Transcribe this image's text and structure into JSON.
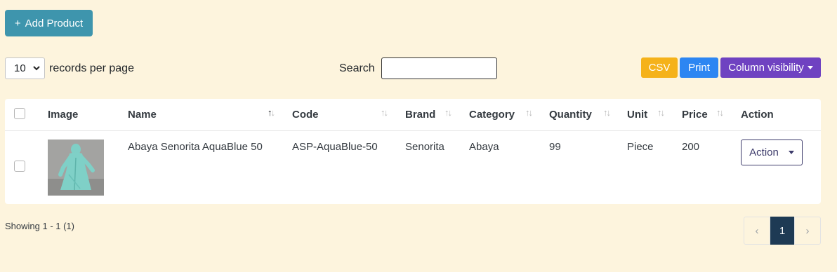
{
  "toolbar": {
    "add_icon": "+",
    "add_label": "Add Product"
  },
  "length": {
    "value": "10",
    "label": "records per page"
  },
  "search": {
    "label": "Search",
    "value": "",
    "placeholder": ""
  },
  "export": {
    "csv": "CSV",
    "print": "Print",
    "colvis": "Column visibility"
  },
  "table": {
    "headers": [
      "Image",
      "Name",
      "Code",
      "Brand",
      "Category",
      "Quantity",
      "Unit",
      "Price",
      "Action"
    ],
    "rows": [
      {
        "name": "Abaya Senorita AquaBlue 50",
        "code": "ASP-AquaBlue-50",
        "brand": "Senorita",
        "category": "Abaya",
        "quantity": "99",
        "unit": "Piece",
        "price": "200",
        "action": "Action"
      }
    ]
  },
  "footer": {
    "showing": "Showing 1 - 1 (1)",
    "pages": [
      "1"
    ],
    "prev_icon": "‹",
    "next_icon": "›"
  },
  "colors": {
    "background": "#fdf4dd",
    "add_button": "#3e95ad",
    "csv": "#f5b21a",
    "print": "#2d86f2",
    "colvis": "#6f42c1",
    "active_page": "#1e3a54"
  }
}
